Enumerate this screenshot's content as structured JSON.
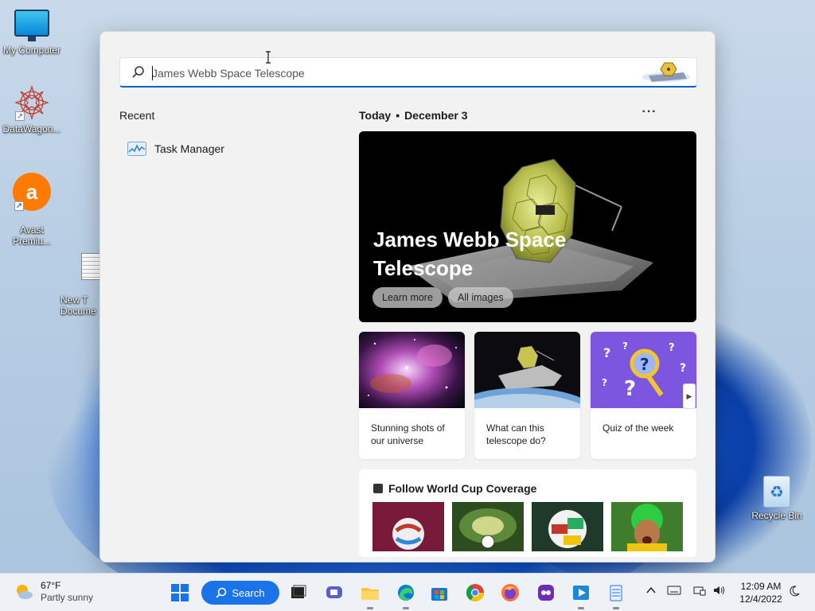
{
  "desktop": {
    "icons": [
      {
        "label": "My Computer"
      },
      {
        "label": "DataWagon..."
      },
      {
        "label": "Avast\nPremiu..."
      },
      {
        "label": "New T\nDocume"
      },
      {
        "label": "Recycle Bin"
      }
    ]
  },
  "search": {
    "value": "James Webb Space Telescope",
    "placeholder": "James Webb Space Telescope"
  },
  "recent": {
    "heading": "Recent",
    "items": [
      {
        "label": "Task Manager",
        "icon": "task-manager-icon"
      }
    ]
  },
  "highlights": {
    "today_label": "Today",
    "date_label": "December 3",
    "more_label": "···",
    "hero": {
      "title": "James Webb Space Telescope",
      "buttons": [
        "Learn more",
        "All images"
      ]
    },
    "cards": [
      {
        "caption": "Stunning shots of our universe"
      },
      {
        "caption": "What can this telescope do?"
      },
      {
        "caption": "Quiz of the week"
      }
    ],
    "world_cup": {
      "heading": "Follow World Cup Coverage"
    }
  },
  "taskbar": {
    "weather": {
      "temp": "67°F",
      "condition": "Partly sunny"
    },
    "search_label": "Search",
    "apps": [
      "start",
      "search",
      "task-view",
      "teams-chat",
      "file-explorer",
      "edge",
      "microsoft-store",
      "chrome",
      "firefox",
      "app-purple",
      "media-player",
      "notepad"
    ],
    "clock": {
      "time": "12:09 AM",
      "date": "12/4/2022"
    }
  },
  "colors": {
    "accent": "#1a73e8",
    "panel_bg": "#f2f2f2",
    "search_underline": "#0a5fd0"
  }
}
